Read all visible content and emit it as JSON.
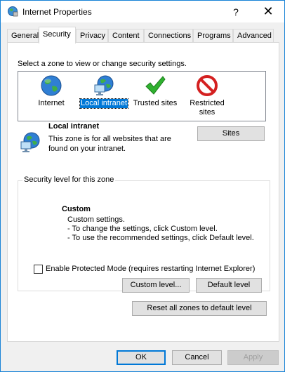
{
  "window": {
    "title": "Internet Properties",
    "help_glyph": "?",
    "close_glyph": "✕"
  },
  "tabs": [
    {
      "label": "General"
    },
    {
      "label": "Security"
    },
    {
      "label": "Privacy"
    },
    {
      "label": "Content"
    },
    {
      "label": "Connections"
    },
    {
      "label": "Programs"
    },
    {
      "label": "Advanced"
    }
  ],
  "active_tab": "Security",
  "zone_prompt": "Select a zone to view or change security settings.",
  "zones": [
    {
      "label": "Internet",
      "icon": "globe-icon",
      "selected": false
    },
    {
      "label": "Local intranet",
      "icon": "network-globe-icon",
      "selected": true
    },
    {
      "label": "Trusted sites",
      "icon": "check-icon",
      "selected": false
    },
    {
      "label": "Restricted sites",
      "icon": "prohibited-icon",
      "selected": false
    }
  ],
  "zone_info": {
    "name": "Local intranet",
    "description_line1": "This zone is for all websites that are",
    "description_line2": "found on your intranet.",
    "sites_button": "Sites"
  },
  "security_level": {
    "group_title": "Security level for this zone",
    "level_name": "Custom",
    "line1": "Custom settings.",
    "line2": "- To change the settings, click Custom level.",
    "line3": "- To use the recommended settings, click Default level."
  },
  "protected_mode": {
    "label": "Enable Protected Mode (requires restarting Internet Explorer)",
    "checked": false
  },
  "buttons": {
    "custom_level": "Custom level...",
    "default_level": "Default level",
    "reset_all": "Reset all zones to default level",
    "ok": "OK",
    "cancel": "Cancel",
    "apply": "Apply"
  },
  "colors": {
    "selection": "#0078d7",
    "window_border": "#1883d7",
    "check_green": "#2fb12f",
    "prohibited_red": "#d42020"
  }
}
